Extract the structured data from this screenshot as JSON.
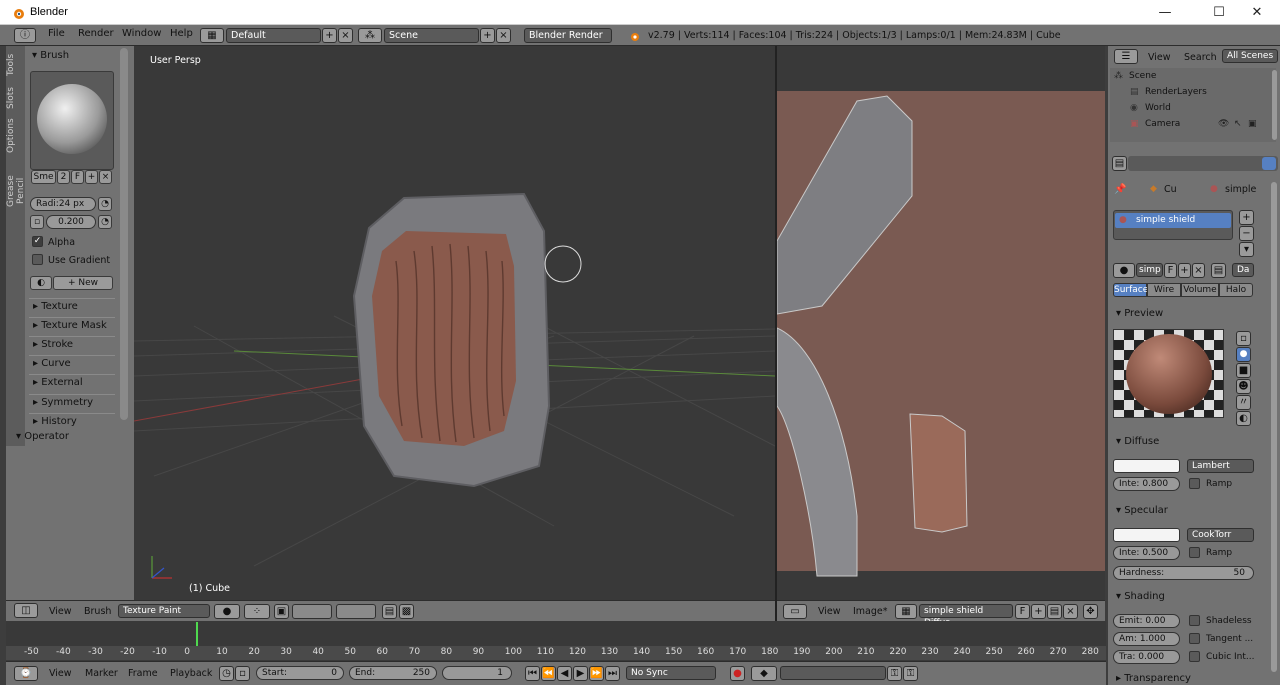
{
  "window": {
    "title": "Blender",
    "minimize": "—",
    "maximize": "☐",
    "close": "✕"
  },
  "infobar": {
    "menus": [
      "File",
      "Render",
      "Window",
      "Help"
    ],
    "layout": "Default",
    "scene": "Scene",
    "engine": "Blender Render",
    "stats": "v2.79 | Verts:114 | Faces:104 | Tris:224 | Objects:1/3 | Lamps:0/1 | Mem:24.83M | Cube"
  },
  "vtabs": [
    "Tools",
    "Slots",
    "Options",
    "Grease Pencil"
  ],
  "toolpanel": {
    "brush_header": "Brush",
    "brush_name": "Sme",
    "brush_users": "2",
    "brush_fake": "F",
    "radius": "Radi:24 px",
    "strength": "0.200",
    "alpha_label": "Alpha",
    "gradient_label": "Use Gradient",
    "new_label": "New",
    "sections": [
      "Texture",
      "Texture Mask",
      "Stroke",
      "Curve",
      "External",
      "Symmetry",
      "History"
    ],
    "operator": "Operator"
  },
  "viewport3d": {
    "view_label": "User Persp",
    "object_label": "(1) Cube"
  },
  "view3d_header": {
    "view": "View",
    "brush": "Brush",
    "mode": "Texture Paint"
  },
  "uv_header": {
    "view": "View",
    "image": "Image*",
    "image_name": "simple shield Diffus...",
    "fake": "F"
  },
  "timeline": {
    "ticks": [
      "-50",
      "-40",
      "-30",
      "-20",
      "-10",
      "0",
      "10",
      "20",
      "30",
      "40",
      "50",
      "60",
      "70",
      "80",
      "90",
      "100",
      "110",
      "120",
      "130",
      "140",
      "150",
      "160",
      "170",
      "180",
      "190",
      "200",
      "210",
      "220",
      "230",
      "240",
      "250",
      "260",
      "270",
      "280"
    ],
    "menus": [
      "View",
      "Marker",
      "Frame",
      "Playback"
    ],
    "start": "Start:",
    "start_val": "0",
    "end": "End:",
    "end_val": "250",
    "current": "1",
    "sync": "No Sync"
  },
  "outliner": {
    "view": "View",
    "search": "Search",
    "filter": "All Scenes",
    "items": [
      "Scene",
      "RenderLayers",
      "World",
      "Camera"
    ]
  },
  "props": {
    "crumb_obj": "Cu",
    "crumb_mat": "simple",
    "material_slot": "simple shield",
    "mat_name": "simp",
    "mat_f": "F",
    "data_dd": "Da",
    "tabs": [
      "Surface",
      "Wire",
      "Volume",
      "Halo"
    ],
    "preview": "Preview",
    "diffuse": "Diffuse",
    "diffuse_shader": "Lambert",
    "diffuse_intensity": "Inte: 0.800",
    "ramp": "Ramp",
    "specular": "Specular",
    "spec_shader": "CookTorr",
    "spec_intensity": "Inte: 0.500",
    "hardness_label": "Hardness:",
    "hardness_val": "50",
    "shading": "Shading",
    "emit": "Emit: 0.00",
    "shadeless": "Shadeless",
    "ambient": "Am: 1.000",
    "tangent": "Tangent ...",
    "translucency": "Tra: 0.000",
    "cubic": "Cubic Int...",
    "transparency": "Transparency"
  }
}
